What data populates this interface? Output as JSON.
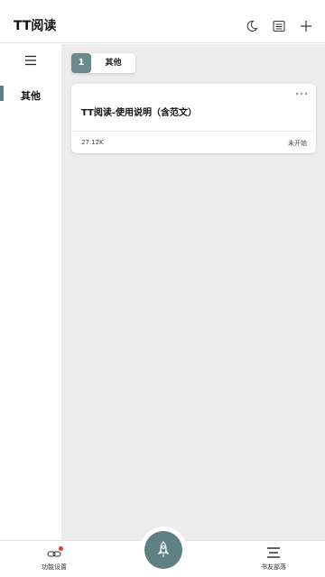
{
  "header": {
    "title": "TT阅读",
    "icons": [
      "moon-icon",
      "list-icon",
      "plus-icon"
    ]
  },
  "sidebar": {
    "menu_icon": "hamburger-icon",
    "items": [
      {
        "label": "其他",
        "selected": true
      }
    ]
  },
  "main": {
    "group": {
      "number": "1",
      "name": "其他"
    },
    "books": [
      {
        "title": "TT阅读-使用说明（含范文）",
        "size": "27.12K",
        "status": "未开始"
      }
    ]
  },
  "bottom_bar": {
    "left_tab": {
      "label": "功能设置",
      "icon": "link-icon",
      "badge": true
    },
    "center_button": {
      "icon": "rocket-icon"
    },
    "right_tab": {
      "label": "书友部落",
      "icon": "menu-lines-icon"
    }
  },
  "colors": {
    "accent": "#5f8085",
    "badge": "#e53935",
    "content_bg": "#ececec"
  }
}
